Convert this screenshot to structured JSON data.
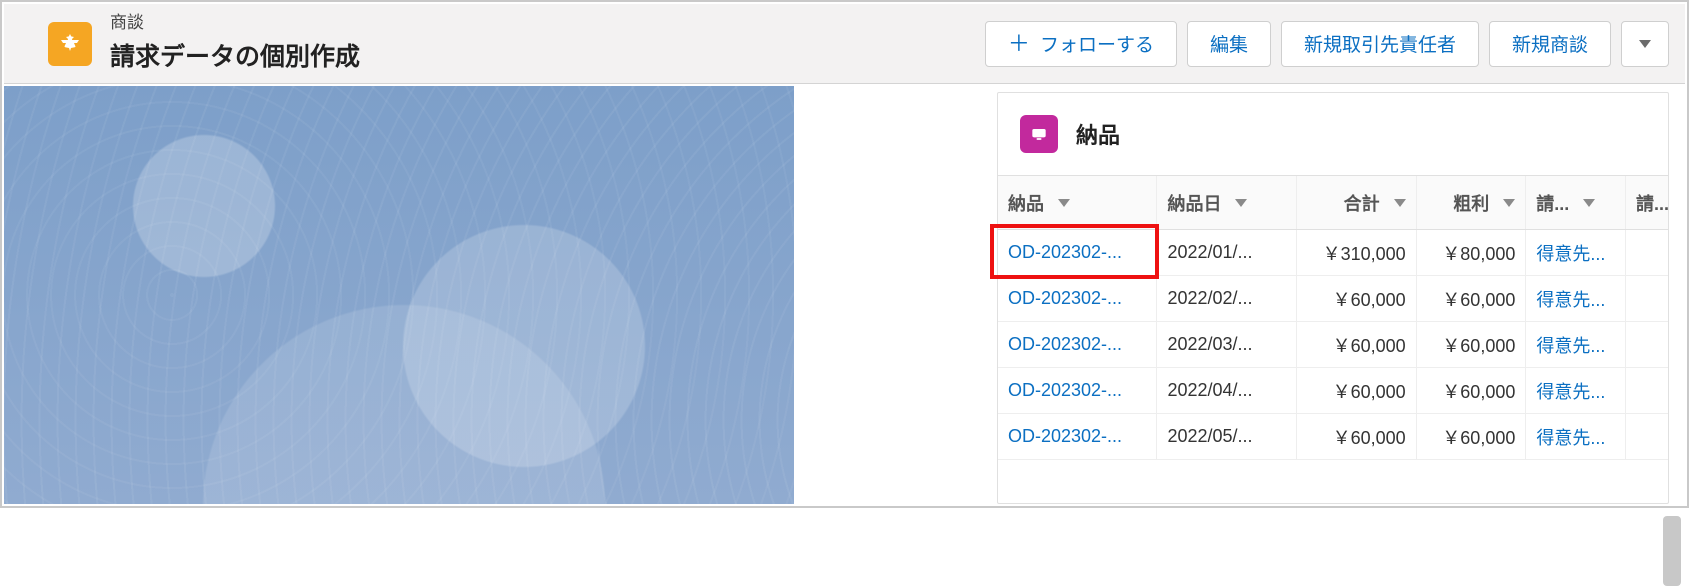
{
  "header": {
    "object_label": "商談",
    "page_title": "請求データの個別作成",
    "actions": {
      "follow": "フォローする",
      "edit": "編集",
      "new_contact": "新規取引先責任者",
      "new_opportunity": "新規商談"
    }
  },
  "panel": {
    "title": "納品",
    "columns": {
      "item": "納品",
      "date": "納品日",
      "total": "合計",
      "profit": "粗利",
      "billing_a": "請...",
      "billing_b": "請..."
    },
    "rows": [
      {
        "item": "OD-202302-...",
        "date": "2022/01/...",
        "total": "￥310,000",
        "profit": "￥80,000",
        "billing": "得意先..."
      },
      {
        "item": "OD-202302-...",
        "date": "2022/02/...",
        "total": "￥60,000",
        "profit": "￥60,000",
        "billing": "得意先..."
      },
      {
        "item": "OD-202302-...",
        "date": "2022/03/...",
        "total": "￥60,000",
        "profit": "￥60,000",
        "billing": "得意先..."
      },
      {
        "item": "OD-202302-...",
        "date": "2022/04/...",
        "total": "￥60,000",
        "profit": "￥60,000",
        "billing": "得意先..."
      },
      {
        "item": "OD-202302-...",
        "date": "2022/05/...",
        "total": "￥60,000",
        "profit": "￥60,000",
        "billing": "得意先..."
      }
    ],
    "highlight_row_index": 0
  }
}
